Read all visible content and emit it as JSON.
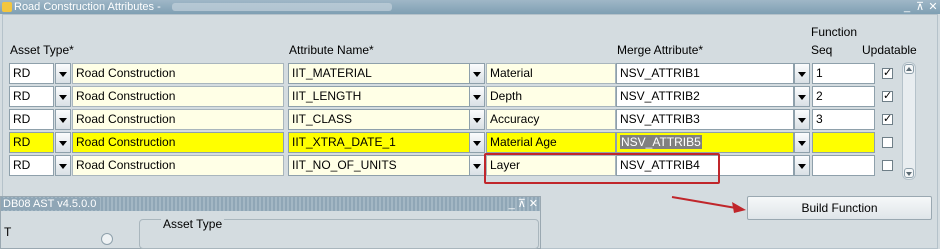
{
  "window": {
    "title": "Road Construction Attributes -",
    "controls": [
      "_",
      "⊼",
      "✕"
    ]
  },
  "headers": {
    "asset_type": "Asset Type*",
    "attribute_name": "Attribute Name*",
    "merge_attribute": "Merge Attribute*",
    "function_seq_line1": "Function",
    "function_seq_line2": "Seq",
    "updatable": "Updatable"
  },
  "rows": [
    {
      "asset_type": "RD",
      "asset_desc": "Road Construction",
      "attribute_name": "IIT_MATERIAL",
      "attribute_desc": "Material",
      "merge_attribute": "NSV_ATTRIB1",
      "seq": "1",
      "updatable": "✓"
    },
    {
      "asset_type": "RD",
      "asset_desc": "Road Construction",
      "attribute_name": "IIT_LENGTH",
      "attribute_desc": "Depth",
      "merge_attribute": "NSV_ATTRIB2",
      "seq": "2",
      "updatable": "✓"
    },
    {
      "asset_type": "RD",
      "asset_desc": "Road Construction",
      "attribute_name": "IIT_CLASS",
      "attribute_desc": "Accuracy",
      "merge_attribute": "NSV_ATTRIB3",
      "seq": "3",
      "updatable": "✓"
    },
    {
      "asset_type": "RD",
      "asset_desc": "Road Construction",
      "attribute_name": "IIT_XTRA_DATE_1",
      "attribute_desc": "Material Age",
      "merge_attribute": "NSV_ATTRIB5",
      "seq": "",
      "updatable": ""
    },
    {
      "asset_type": "RD",
      "asset_desc": "Road Construction",
      "attribute_name": "IIT_NO_OF_UNITS",
      "attribute_desc": "Layer",
      "merge_attribute": "NSV_ATTRIB4",
      "seq": "",
      "updatable": ""
    }
  ],
  "build_button": "Build Function",
  "second_window": {
    "title": "DB08 AST v4.5.0.0",
    "controls": [
      "_",
      "⊼",
      "✕"
    ],
    "field_label": "Asset Type",
    "edge_text": "T"
  },
  "colors": {
    "highlight_row": "#ffff00",
    "selection": "#808080",
    "annotation": "#c0262b"
  }
}
